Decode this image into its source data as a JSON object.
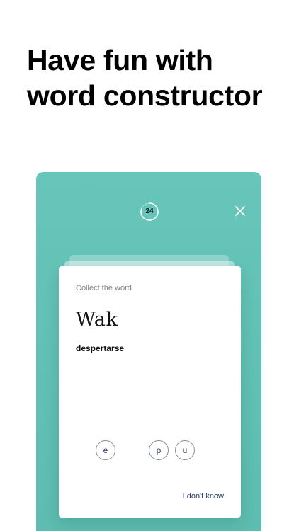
{
  "headline": {
    "line1": "Have fun with",
    "line2": "word constructor"
  },
  "colors": {
    "panel": "#5fc0b4",
    "card": "#ffffff",
    "timer_ring": "#ffffff",
    "letter_text": "#1f3b5a",
    "link": "#1f3b6a"
  },
  "timer": {
    "value": "24",
    "progress": 0.8
  },
  "close_icon": "close-icon",
  "card": {
    "prompt": "Collect the word",
    "word": "Wak",
    "translation": "despertarse",
    "letters": [
      "e",
      "p",
      "u"
    ],
    "dont_know_label": "I don't know"
  }
}
